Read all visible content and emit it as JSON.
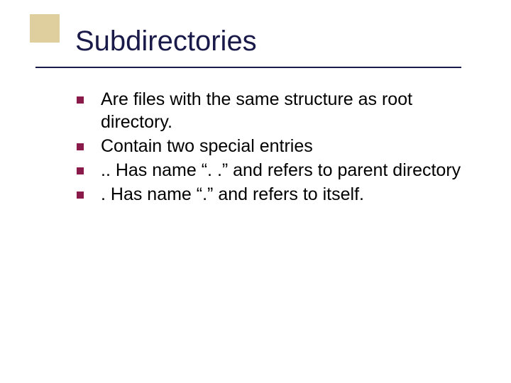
{
  "slide": {
    "title": "Subdirectories",
    "bullets": [
      "Are files with the same structure as root directory.",
      "Contain two special entries",
      "..   Has name “. .” and refers to parent directory",
      ".    Has name “.” and refers to itself."
    ]
  }
}
